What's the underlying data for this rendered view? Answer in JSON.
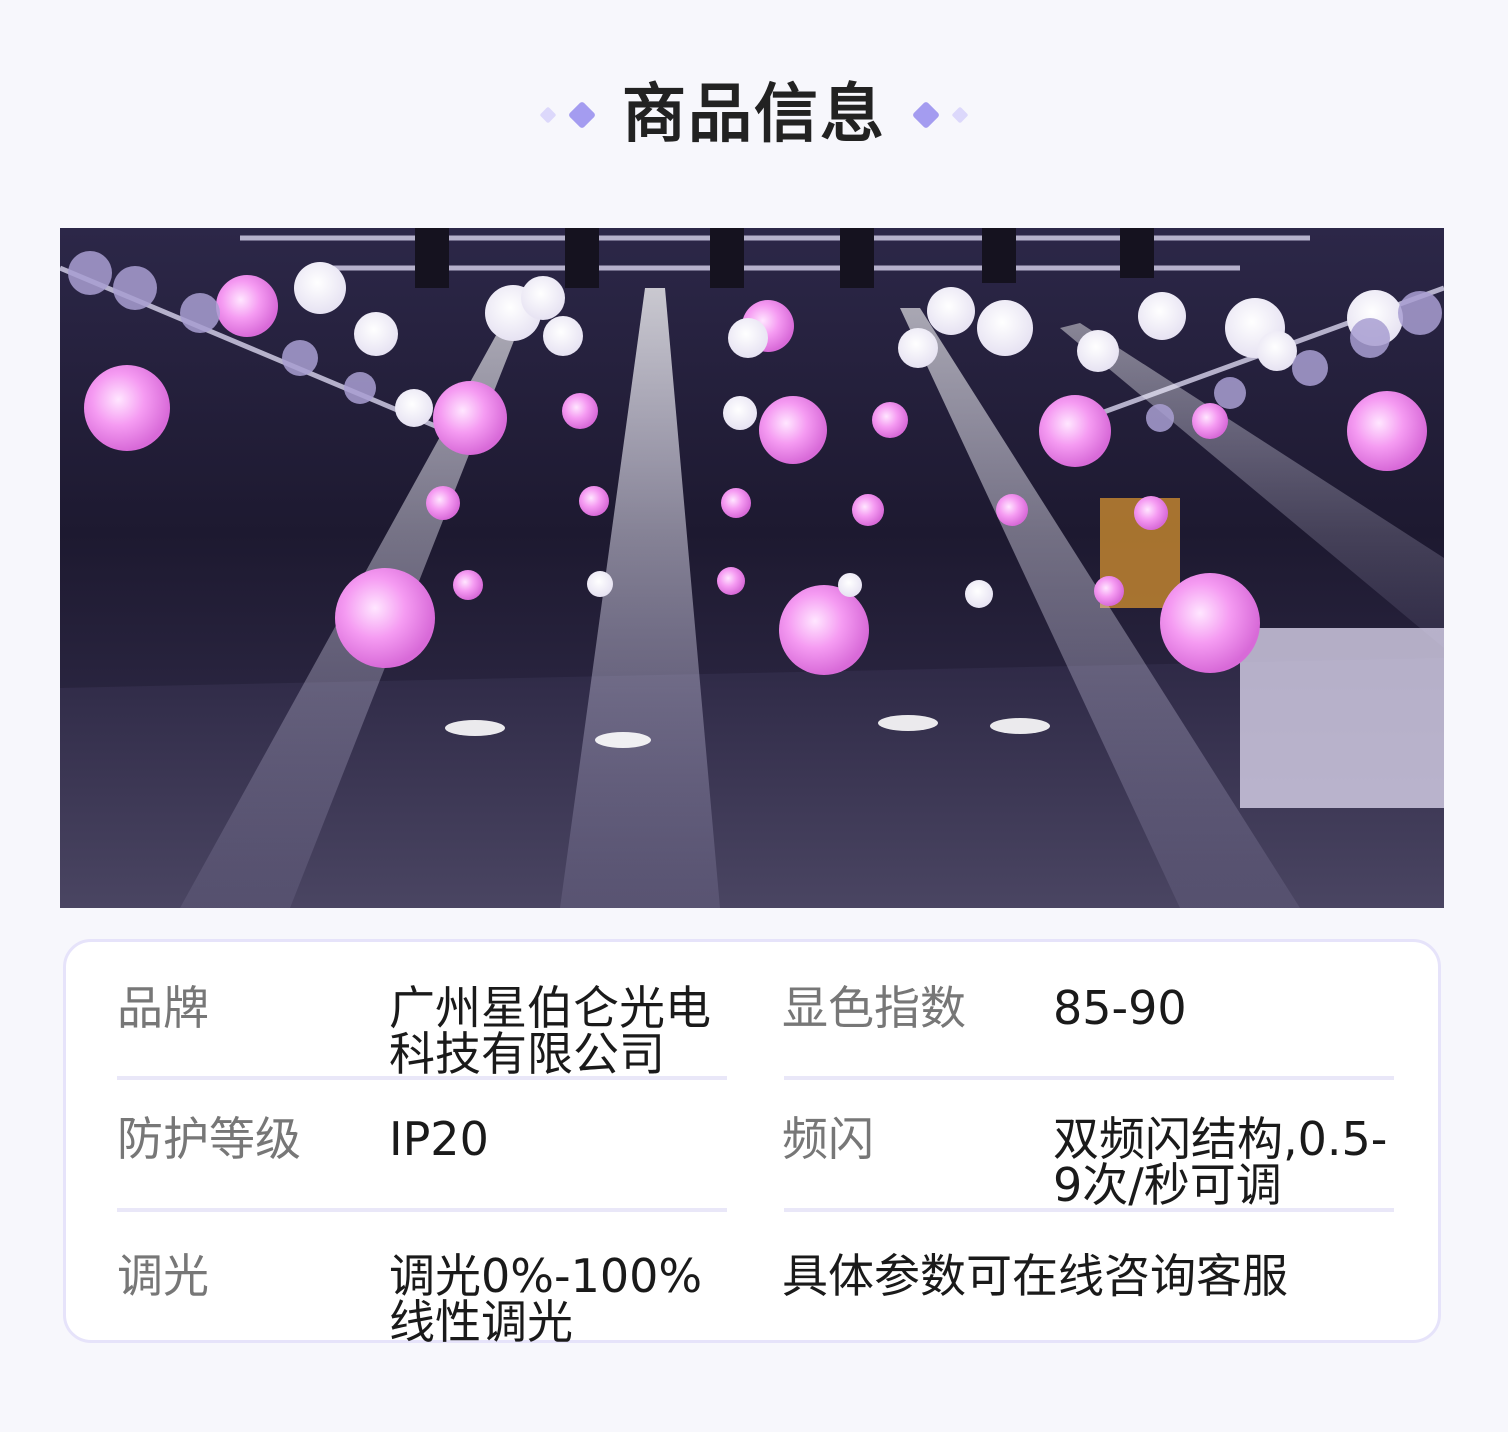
{
  "header": {
    "title": "商品信息"
  },
  "photo": {
    "subject": "hanging-led-spheres-stage-photo"
  },
  "colors": {
    "accent": "#a49cf0",
    "accent_light": "#dcd8fb",
    "card_border": "#e6e3fa"
  },
  "specs": {
    "r1": {
      "l1": "品牌",
      "v1a": "广州星伯仑光电",
      "v1b": "科技有限公司",
      "l2": "显色指数",
      "v2": "85-90"
    },
    "r2": {
      "l1": "防护等级",
      "v1": "IP20",
      "l2": "频闪",
      "v2a": "双频闪结构,0.5-",
      "v2b": "9次/秒可调"
    },
    "r3": {
      "l1": "调光",
      "v1a": "调光0%-100%",
      "v1b": "线性调光",
      "note": "具体参数可在线咨询客服"
    }
  }
}
